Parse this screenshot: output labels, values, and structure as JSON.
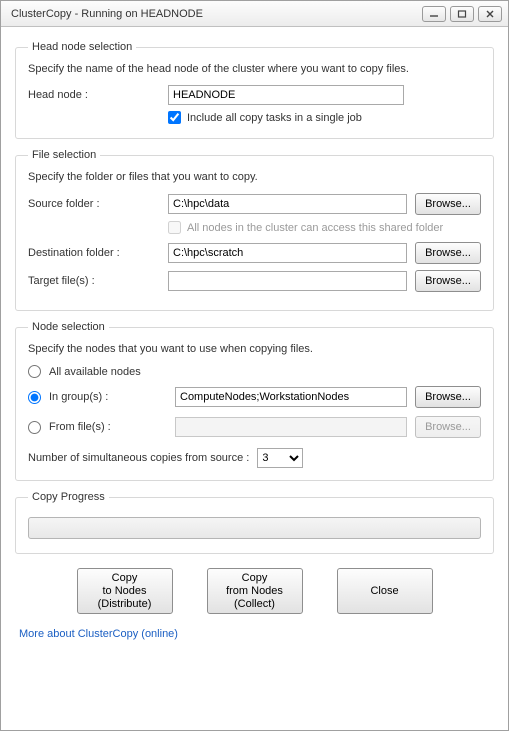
{
  "window": {
    "title": "ClusterCopy - Running on HEADNODE"
  },
  "headnode": {
    "legend": "Head node selection",
    "desc": "Specify the name of the head node of the cluster where you want to copy files.",
    "label": "Head node :",
    "value": "HEADNODE",
    "include_label": "Include all copy tasks in a single job"
  },
  "files": {
    "legend": "File selection",
    "desc": "Specify the folder or files that you want to copy.",
    "source_label": "Source folder :",
    "source_value": "C:\\hpc\\data",
    "shared_label": "All nodes in the cluster can access this shared folder",
    "dest_label": "Destination folder :",
    "dest_value": "C:\\hpc\\scratch",
    "target_label": "Target file(s) :",
    "target_value": "",
    "browse": "Browse..."
  },
  "nodes": {
    "legend": "Node selection",
    "desc": "Specify the nodes that you want to use when copying files.",
    "all_label": "All available nodes",
    "groups_label": "In group(s) :",
    "groups_value": "ComputeNodes;WorkstationNodes",
    "file_label": "From file(s) :",
    "file_value": "",
    "browse": "Browse...",
    "simul_label": "Number of simultaneous copies from source :",
    "simul_value": "3"
  },
  "progress": {
    "legend": "Copy Progress"
  },
  "buttons": {
    "distribute": "Copy\nto Nodes\n(Distribute)",
    "collect": "Copy\nfrom Nodes\n(Collect)",
    "close": "Close"
  },
  "link": "More about ClusterCopy (online)"
}
